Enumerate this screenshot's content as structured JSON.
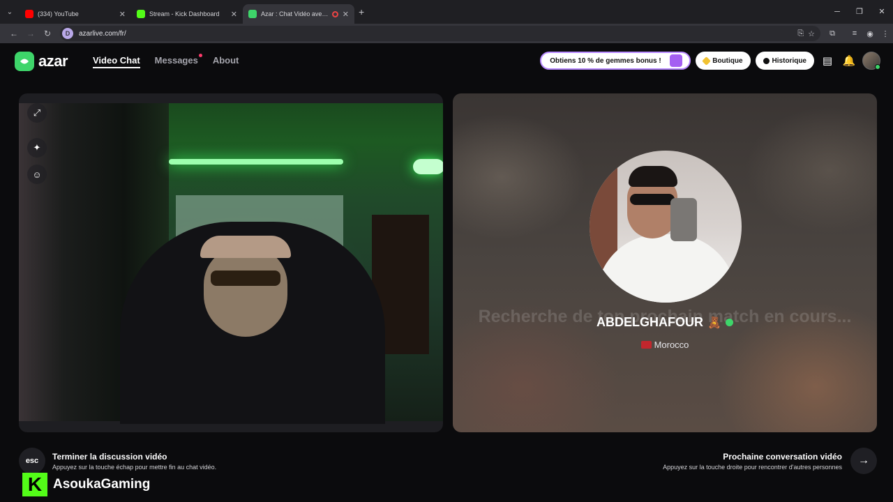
{
  "browser": {
    "tabs": [
      {
        "title": "(334) YouTube",
        "color": "#ff0000"
      },
      {
        "title": "Stream - Kick Dashboard",
        "color": "#53fc18"
      },
      {
        "title": "Azar : Chat Vidéo avec de n",
        "color": "#3ed56a"
      }
    ],
    "url": "azarlive.com/fr/"
  },
  "header": {
    "logo": "azar",
    "nav": [
      {
        "label": "Video Chat"
      },
      {
        "label": "Messages"
      },
      {
        "label": "About"
      }
    ],
    "promo": "Obtiens 10 % de gemmes bonus !",
    "shop_label": "Boutique",
    "history_label": "Historique"
  },
  "match": {
    "searching_text": "Recherche de ton prochain match en cours...",
    "name": "ABDELGHAFOUR",
    "emoji": "🧸",
    "country": "Morocco"
  },
  "footer": {
    "esc_key": "esc",
    "end_title": "Terminer la discussion vidéo",
    "end_sub": "Appuyez sur la touche échap pour mettre fin au chat vidéo.",
    "next_title": "Prochaine conversation vidéo",
    "next_sub": "Appuyez sur la touche droite pour rencontrer d'autres personnes"
  },
  "overlay": {
    "kick_logo": "K",
    "streamer": "AsoukaGaming"
  },
  "colors": {
    "accent": "#3ed56a",
    "kick": "#53fc18"
  }
}
